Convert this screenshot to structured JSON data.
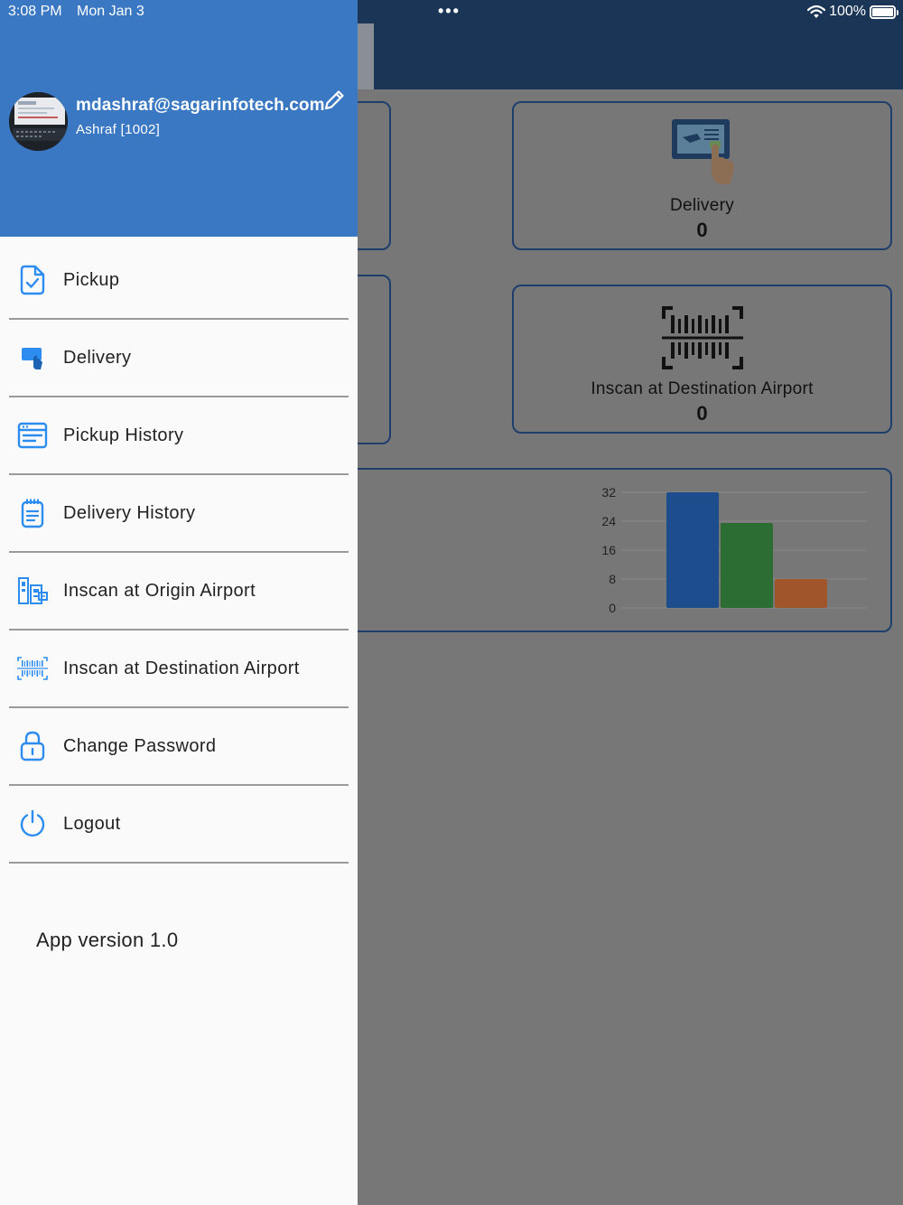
{
  "status_bar": {
    "time": "3:08 PM",
    "date": "Mon Jan 3",
    "dots": "•••",
    "battery_pct": "100%"
  },
  "drawer": {
    "user": {
      "email": "mdashraf@sagarinfotech.com",
      "name": "Ashraf [1002]"
    },
    "menu": [
      {
        "label": "Pickup",
        "icon": "pickup-document-icon"
      },
      {
        "label": "Delivery",
        "icon": "delivery-hand-icon"
      },
      {
        "label": "Pickup History",
        "icon": "pickup-history-icon"
      },
      {
        "label": "Delivery History",
        "icon": "delivery-history-icon"
      },
      {
        "label": "Inscan at Origin Airport",
        "icon": "origin-airport-icon"
      },
      {
        "label": "Inscan at Destination Airport",
        "icon": "barcode-scan-icon"
      },
      {
        "label": "Change Password",
        "icon": "lock-icon"
      },
      {
        "label": "Logout",
        "icon": "power-icon"
      }
    ],
    "app_version": "App version 1.0",
    "accent_color": "#2d8cf0",
    "header_color": "#3a78c3"
  },
  "dashboard": {
    "cards": [
      {
        "label": "Delivery",
        "count": "0"
      },
      {
        "label": "Inscan at Destination Airport",
        "count": "0"
      }
    ]
  },
  "chart_data": {
    "type": "bar",
    "y_ticks": [
      "32",
      "24",
      "16",
      "8",
      "0"
    ],
    "ylim": [
      0,
      32
    ],
    "values": [
      32,
      23.5,
      8
    ],
    "colors": [
      "#1d4d8c",
      "#2c6d34",
      "#a0562a"
    ]
  }
}
